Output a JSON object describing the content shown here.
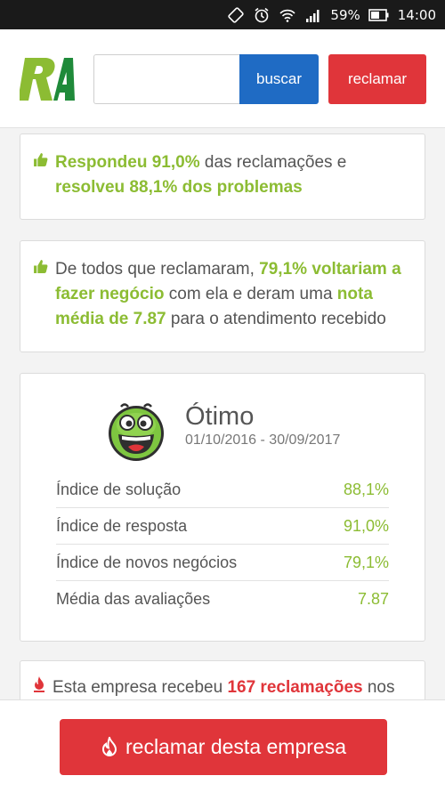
{
  "status_bar": {
    "battery": "59%",
    "time": "14:00",
    "icons": [
      "rotate-icon",
      "alarm-icon",
      "wifi-icon",
      "signal-icon",
      "battery-icon"
    ]
  },
  "header": {
    "logo_alt": "RA",
    "search_placeholder": "",
    "search_value": "",
    "search_button": "buscar",
    "reclamar_button": "reclamar"
  },
  "card1": {
    "highlight1": "Respondeu 91,0%",
    "text1": " das reclamações e ",
    "highlight2": "resolveu 88,1% dos problemas"
  },
  "card2": {
    "text1": "De todos que reclamaram, ",
    "highlight1": "79,1% voltariam a fazer negócio",
    "text2": " com ela e deram uma ",
    "highlight2": "nota média de 7.87",
    "text3": " para o atendimento recebido"
  },
  "rating": {
    "label": "Ótimo",
    "period": "01/10/2016 - 30/09/2017",
    "metrics": [
      {
        "name": "Índice de solução",
        "value": "88,1%"
      },
      {
        "name": "Índice de resposta",
        "value": "91,0%"
      },
      {
        "name": "Índice de novos negócios",
        "value": "79,1%"
      },
      {
        "name": "Média das avaliações",
        "value": "7.87"
      }
    ]
  },
  "card4": {
    "text1": "Esta empresa recebeu ",
    "highlight": "167 reclamações",
    "text2": " nos"
  },
  "bottom": {
    "button_label": "reclamar desta empresa"
  },
  "colors": {
    "green": "#8cbc33",
    "red": "#e0353a",
    "blue": "#1f6bc4"
  }
}
